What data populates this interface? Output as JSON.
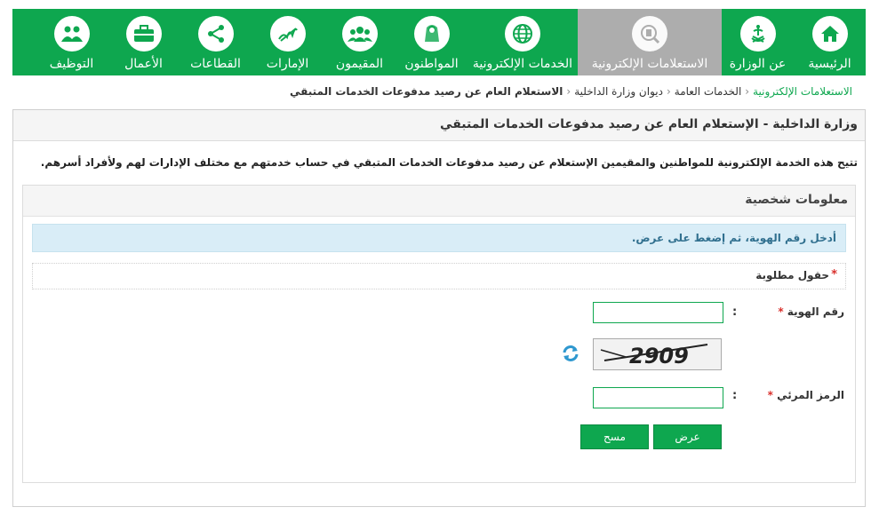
{
  "nav": {
    "items": [
      {
        "label": "الرئيسية",
        "icon": "home-icon"
      },
      {
        "label": "عن الوزارة",
        "icon": "emblem-icon"
      },
      {
        "label": "الاستعلامات الإلكترونية",
        "icon": "inquiry-icon"
      },
      {
        "label": "الخدمات الإلكترونية",
        "icon": "globe-icon"
      },
      {
        "label": "المواطنون",
        "icon": "citizen-icon"
      },
      {
        "label": "المقيمون",
        "icon": "residents-icon"
      },
      {
        "label": "الإمارات",
        "icon": "calligraphy-icon"
      },
      {
        "label": "القطاعات",
        "icon": "share-icon"
      },
      {
        "label": "الأعمال",
        "icon": "briefcase-icon"
      },
      {
        "label": "التوظيف",
        "icon": "people-icon"
      }
    ],
    "active_index": 2,
    "colors": {
      "bar": "#0ea74f",
      "active": "#adadad"
    }
  },
  "breadcrumb": {
    "items": [
      "الاستعلامات الإلكترونية",
      "الخدمات العامة",
      "ديوان وزارة الداخلية",
      "الاستعلام العام عن رصيد مدفوعات الخدمات المتبقي"
    ]
  },
  "page": {
    "title": "وزارة الداخلية - الإستعلام العام عن رصيد مدفوعات الخدمات المتبقي",
    "intro": "تتيح هذه الخدمة الإلكترونية للمواطنين والمقيمين الإستعلام عن رصيد مدفوعات الخدمات المتبقي في حساب خدمتهم مع مختلف الإدارات لهم ولأفراد أسرهم."
  },
  "section": {
    "title": "معلومات شخصية",
    "alert": "أدخل رقم الهوية، ثم إضغط على عرض.",
    "required_note": "حقول مطلوبة",
    "required_star": "*"
  },
  "form": {
    "id_label": "رقم الهوية",
    "id_value": "",
    "captcha_label": "الرمز المرئي",
    "captcha_value": "",
    "captcha_text": "2909",
    "colon": ":",
    "submit_label": "عرض",
    "clear_label": "مسح"
  }
}
